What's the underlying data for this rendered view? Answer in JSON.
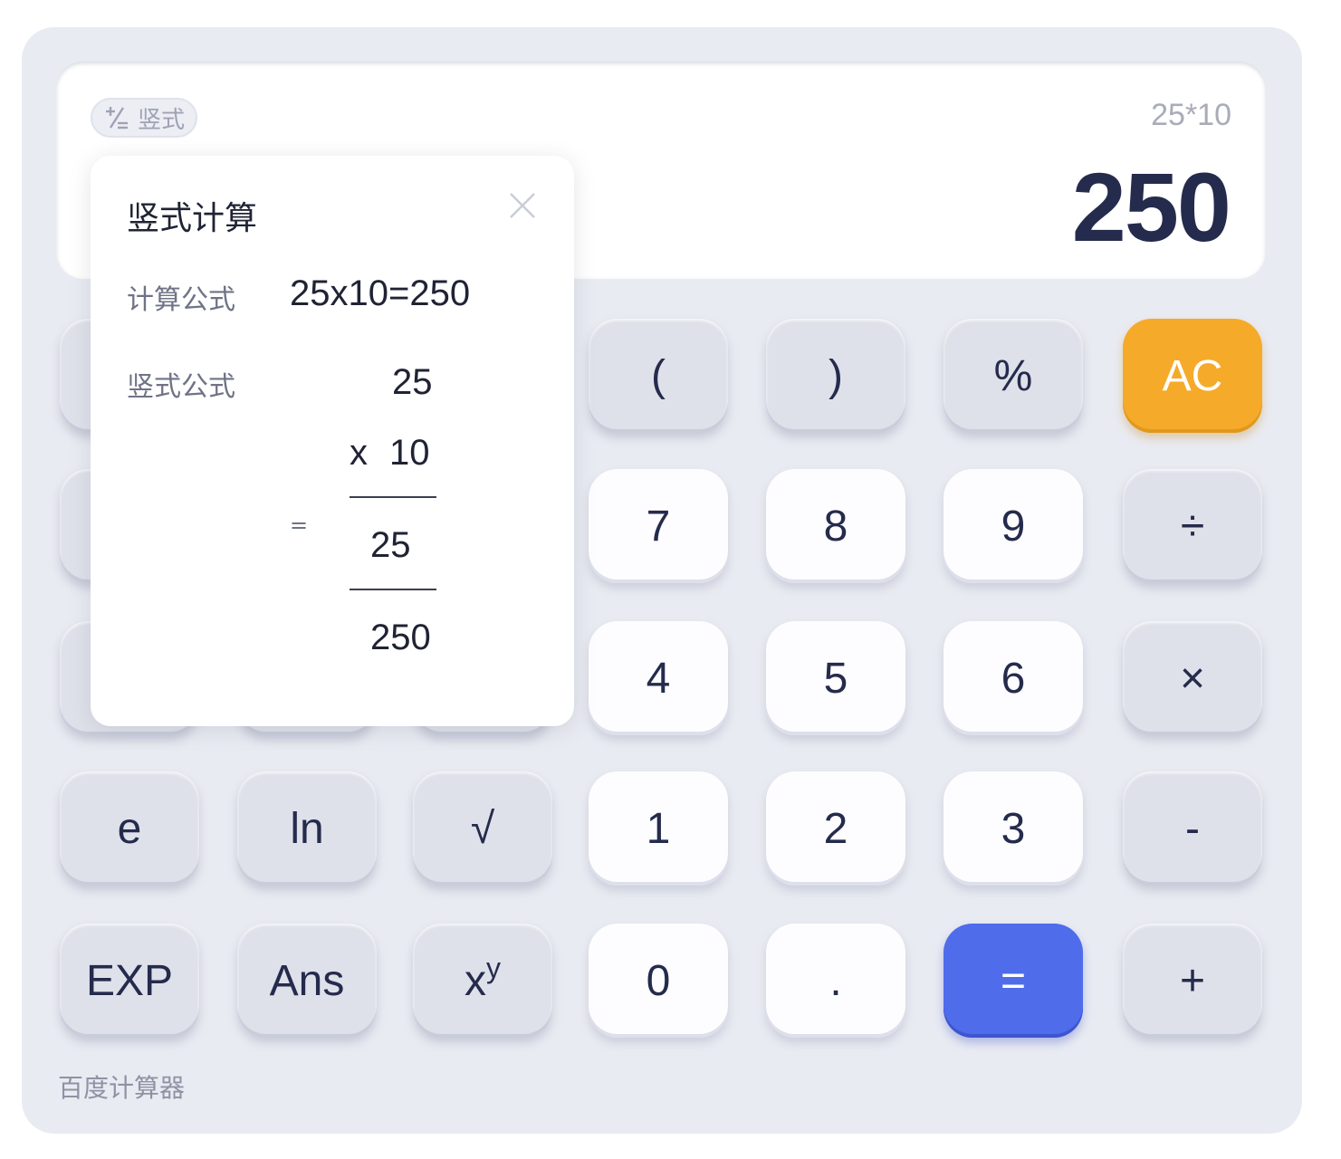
{
  "display": {
    "mode_label": "竖式",
    "expression": "25*10",
    "result": "250"
  },
  "keypad": {
    "rows": [
      [
        {
          "label": "("
        },
        {
          "label": ")"
        },
        {
          "label": "%"
        },
        {
          "label": "AC"
        }
      ],
      [
        {
          "label": "7"
        },
        {
          "label": "8"
        },
        {
          "label": "9"
        },
        {
          "label": "÷"
        }
      ],
      [
        {
          "label": "4"
        },
        {
          "label": "5"
        },
        {
          "label": "6"
        },
        {
          "label": "×"
        }
      ],
      [
        {
          "label": "e"
        },
        {
          "label": "ln"
        },
        {
          "label": "√"
        },
        {
          "label": "1"
        },
        {
          "label": "2"
        },
        {
          "label": "3"
        },
        {
          "label": "-"
        }
      ],
      [
        {
          "label": "EXP"
        },
        {
          "label": "Ans"
        },
        {
          "label": "x",
          "sup": "y"
        },
        {
          "label": "0"
        },
        {
          "label": "."
        },
        {
          "label": "="
        },
        {
          "label": "+"
        }
      ]
    ]
  },
  "popup": {
    "title": "竖式计算",
    "formula_label": "计算公式",
    "formula_value": "25x10=250",
    "vertical_label": "竖式公式",
    "vertical": {
      "multiplicand": "25",
      "operator": "x",
      "multiplier": "10",
      "equals": "=",
      "partial": "25",
      "total": "250"
    }
  },
  "footer": {
    "brand": "百度计算器"
  },
  "colors": {
    "background": "#e9ebf2",
    "accent_ac": "#f6aa2a",
    "accent_equals": "#4f6ceb",
    "text_dark": "#252b4c"
  },
  "icons": {
    "mode_toggle": "plus-minus-icon",
    "popup_close": "close-icon"
  }
}
